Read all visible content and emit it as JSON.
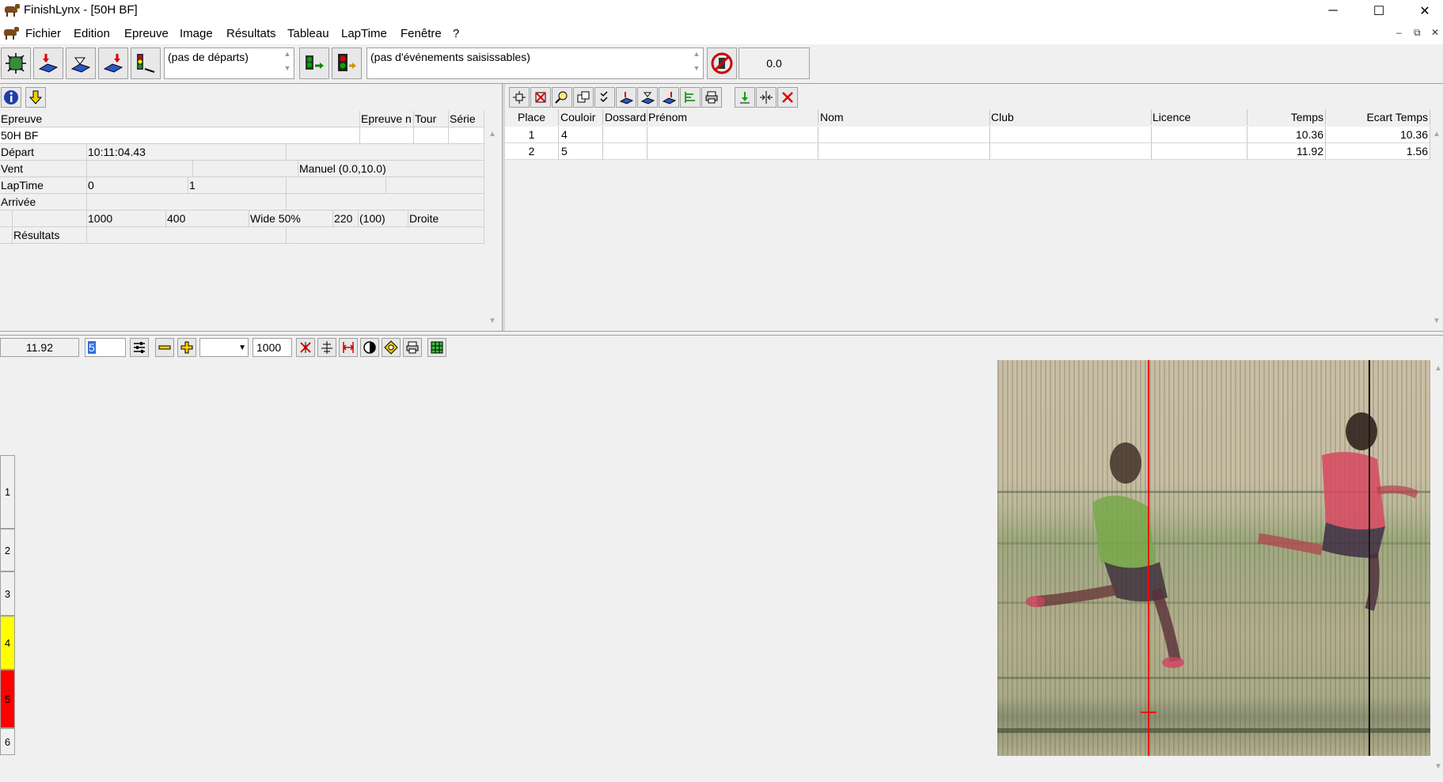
{
  "window": {
    "title": "FinishLynx - [50H BF]",
    "minimize": "─",
    "maximize": "☐",
    "close": "✕"
  },
  "menu": {
    "items": [
      "Fichier",
      "Edition",
      "Epreuve",
      "Image",
      "Résultats",
      "Tableau",
      "LapTime",
      "Fenêtre",
      "?"
    ],
    "mdi_min": "–",
    "mdi_restore": "⧉",
    "mdi_close": "✕"
  },
  "toolbar": {
    "starts_combo": "(pas de départs)",
    "events_combo": "(pas d'événements saisissables)",
    "wind_value": "0.0"
  },
  "event_info": {
    "headers": {
      "event": "Epreuve",
      "event_no": "Epreuve n",
      "round": "Tour",
      "heat": "Série"
    },
    "event_name": "50H BF",
    "depart_label": "Départ",
    "depart_time": "10:11:04.43",
    "wind_label": "Vent",
    "wind_mode": "Manuel (0.0,10.0)",
    "laptime_label": "LapTime",
    "laptime_val1": "0",
    "laptime_val2": "1",
    "arrivee_label": "Arrivée",
    "row5": [
      "1000",
      "400",
      "Wide 50%",
      "220",
      "(100)",
      "Droite"
    ],
    "results_label": "Résultats"
  },
  "results": {
    "headers": [
      "Place",
      "Couloir",
      "Dossard",
      "Prénom",
      "Nom",
      "Club",
      "Licence",
      "Temps",
      "Ecart Temps"
    ],
    "rows": [
      {
        "place": "1",
        "lane": "4",
        "bib": "",
        "first": "",
        "last": "",
        "club": "",
        "license": "",
        "time": "10.36",
        "gap": "10.36"
      },
      {
        "place": "2",
        "lane": "5",
        "bib": "",
        "first": "",
        "last": "",
        "club": "",
        "license": "",
        "time": "11.92",
        "gap": "1.56"
      }
    ]
  },
  "image_toolbar": {
    "cursor_time": "11.92",
    "zoom_value": "5",
    "width_value": "1000"
  },
  "lanes": [
    "1",
    "2",
    "3",
    "4",
    "5",
    "6"
  ],
  "colors": {
    "lane4": "#ffff00",
    "lane5": "#ff0000",
    "cursor_line": "#ff0000"
  },
  "icons": {
    "info": "info-icon",
    "down_arrow": "yellow-down-arrow-icon"
  }
}
